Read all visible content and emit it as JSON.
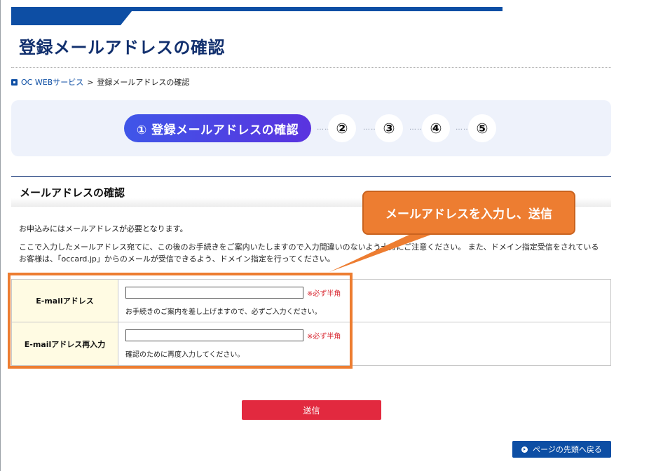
{
  "page": {
    "title": "登録メールアドレスの確認"
  },
  "breadcrumb": {
    "home_label": "OC WEBサービス",
    "separator": ">",
    "current": "登録メールアドレスの確認"
  },
  "steps": {
    "active_label": "① 登録メールアドレスの確認",
    "others": [
      "②",
      "③",
      "④",
      "⑤"
    ],
    "dots": "……"
  },
  "section": {
    "heading": "メールアドレスの確認",
    "intro_line1": "お申込みにはメールアドレスが必要となります。",
    "intro_line2": "ここで入力したメールアドレス宛てに、この後のお手続きをご案内いたしますので入力間違いのないよう十分にご注意ください。 また、ドメイン指定受信をされているお客様は、「occard.jp」からのメールが受信できるよう、ドメイン指定を行ってください。"
  },
  "form": {
    "email_label": "E-mailアドレス",
    "email_value": "",
    "email_required": "※必ず半角",
    "email_hint": "お手続きのご案内を差し上げますので、必ずご入力ください。",
    "email_confirm_label": "E-mailアドレス再入力",
    "email_confirm_value": "",
    "email_confirm_required": "※必ず半角",
    "email_confirm_hint": "確認のために再度入力してください。"
  },
  "callout": {
    "text": "メールアドレスを入力し、送信"
  },
  "buttons": {
    "submit_label": "送信",
    "page_top_label": "ページの先頭へ戻る"
  },
  "colors": {
    "accent_blue": "#0d4ea4",
    "title_navy": "#12306e",
    "annotation_orange": "#ed7d31",
    "submit_red": "#e2293f",
    "required_red": "#d8242e",
    "label_cell_bg": "#fffbe3",
    "steps_panel_bg": "#eef2fb"
  },
  "icons": {
    "breadcrumb": "square-bullet-icon",
    "page_top": "circle-arrow-icon"
  }
}
